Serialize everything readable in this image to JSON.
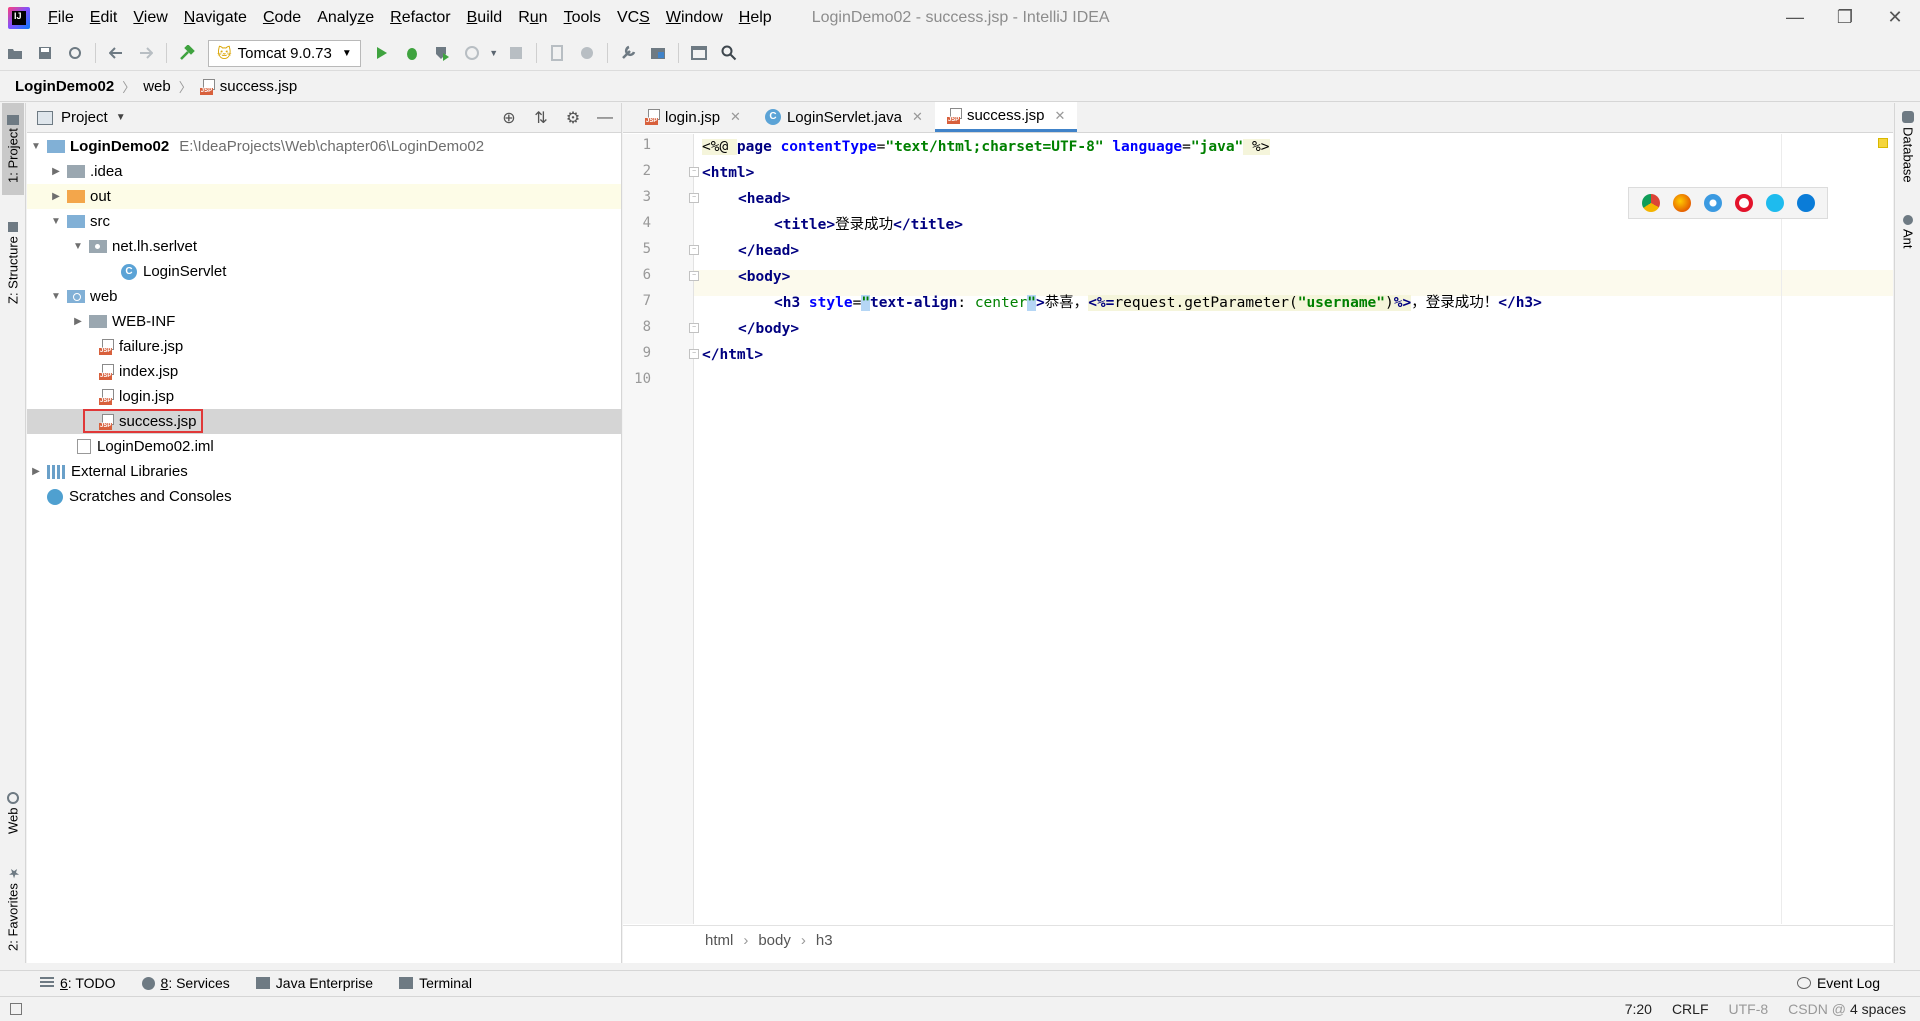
{
  "window": {
    "title": "LoginDemo02 - success.jsp - IntelliJ IDEA",
    "controls": {
      "minimize": "—",
      "restore": "❐",
      "close": "✕"
    }
  },
  "menu": [
    {
      "pre": "",
      "u": "F",
      "post": "ile"
    },
    {
      "pre": "",
      "u": "E",
      "post": "dit"
    },
    {
      "pre": "",
      "u": "V",
      "post": "iew"
    },
    {
      "pre": "",
      "u": "N",
      "post": "avigate"
    },
    {
      "pre": "",
      "u": "C",
      "post": "ode"
    },
    {
      "pre": "Analy",
      "u": "z",
      "post": "e"
    },
    {
      "pre": "",
      "u": "R",
      "post": "efactor"
    },
    {
      "pre": "",
      "u": "B",
      "post": "uild"
    },
    {
      "pre": "R",
      "u": "u",
      "post": "n"
    },
    {
      "pre": "",
      "u": "T",
      "post": "ools"
    },
    {
      "pre": "VC",
      "u": "S",
      "post": ""
    },
    {
      "pre": "",
      "u": "W",
      "post": "indow"
    },
    {
      "pre": "",
      "u": "H",
      "post": "elp"
    }
  ],
  "toolbar": {
    "run_config": "Tomcat 9.0.73"
  },
  "breadcrumb": {
    "project": "LoginDemo02",
    "folder": "web",
    "file": "success.jsp"
  },
  "left_strip": {
    "project_tab": "1: Project",
    "structure_tab": "Z: Structure",
    "web_tab": "Web",
    "favorites_tab": "2: Favorites"
  },
  "right_strip": {
    "database_tab": "Database",
    "ant_tab": "Ant"
  },
  "project_panel": {
    "title": "Project",
    "tree": {
      "root_name": "LoginDemo02",
      "root_path": "E:\\IdeaProjects\\Web\\chapter06\\LoginDemo02",
      "idea": ".idea",
      "out": "out",
      "src": "src",
      "package": "net.lh.serlvet",
      "servlet": "LoginServlet",
      "web": "web",
      "webinf": "WEB-INF",
      "failure": "failure.jsp",
      "index": "index.jsp",
      "login": "login.jsp",
      "success": "success.jsp",
      "iml": "LoginDemo02.iml",
      "libraries": "External Libraries",
      "scratches": "Scratches and Consoles"
    }
  },
  "editor": {
    "tabs": [
      {
        "label": "login.jsp"
      },
      {
        "label": "LoginServlet.java"
      },
      {
        "label": "success.jsp"
      }
    ],
    "line_numbers": [
      "1",
      "2",
      "3",
      "4",
      "5",
      "6",
      "7",
      "8",
      "9",
      "10"
    ],
    "code": {
      "l1_open": "<%@ ",
      "l1_page": "page ",
      "l1_ct_attr": "contentType",
      "l1_eq1": "=",
      "l1_ct_val": "\"text/html;charset=UTF-8\"",
      "l1_lang_attr": " language",
      "l1_eq2": "=",
      "l1_lang_val": "\"java\"",
      "l1_close": " %>",
      "l2": "<html>",
      "l3": "<head>",
      "l4_open": "<title>",
      "l4_text": "登录成功",
      "l4_close": "</title>",
      "l5": "</head>",
      "l6": "<body>",
      "l7_tag": "<h3 ",
      "l7_attr": "style",
      "l7_eq": "=",
      "l7_q1": "\"",
      "l7_prop": "text-align",
      "l7_colon": ": ",
      "l7_val": "center",
      "l7_q2": "\"",
      "l7_gt": ">",
      "l7_text1": "恭喜，",
      "l7_jsp_open": "<%=",
      "l7_expr1": "request.getParameter(",
      "l7_param": "\"username\"",
      "l7_expr2": ")",
      "l7_jsp_close": "%>",
      "l7_text2": "，登录成功！",
      "l7_end": "</h3>",
      "l8": "</body>",
      "l9": "</html>"
    },
    "breadcrumb": [
      "html",
      "body",
      "h3"
    ]
  },
  "bottom_tools": {
    "todo_num": "6",
    "todo_label": ": TODO",
    "services_num": "8",
    "services_label": ": Services",
    "java_ee": "Java Enterprise",
    "terminal": "Terminal",
    "event_log": "Event Log"
  },
  "status": {
    "position": "7:20",
    "line_sep": "CRLF",
    "encoding": "UTF-8",
    "indent": "4 spaces",
    "watermark": "CSDN @"
  },
  "colors": {
    "accent": "#4083c9",
    "selection_box": "#e03838",
    "run_green": "#3fa33f"
  }
}
